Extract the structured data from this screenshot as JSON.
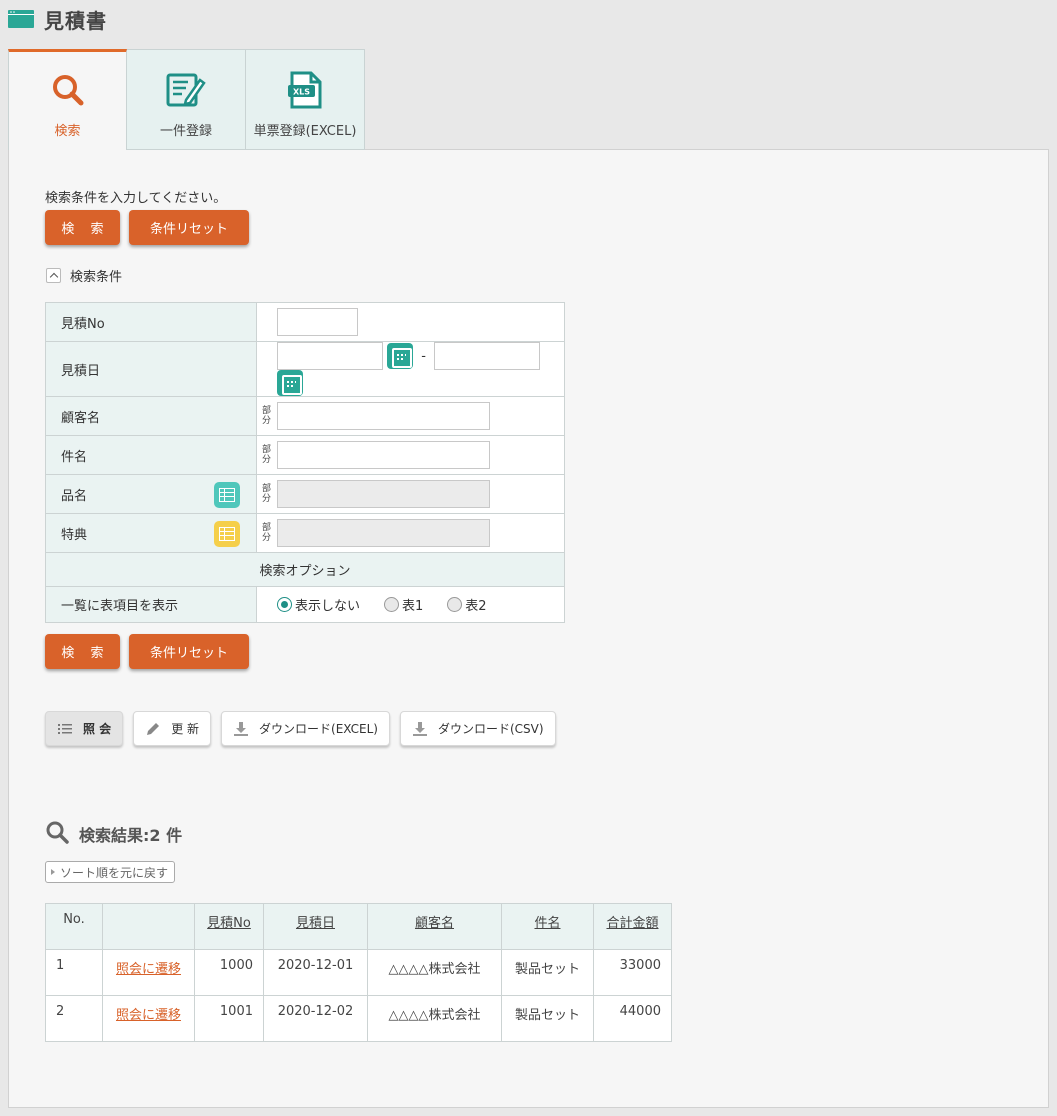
{
  "page": {
    "title": "見積書"
  },
  "tabs": [
    {
      "label": "検索",
      "icon": "search-icon",
      "active": true
    },
    {
      "label": "一件登録",
      "icon": "edit-form-icon",
      "active": false
    },
    {
      "label": "単票登録(EXCEL)",
      "icon": "xls-file-icon",
      "active": false
    }
  ],
  "search": {
    "instruction": "検索条件を入力してください。",
    "search_button": "検 索",
    "reset_button": "条件リセット",
    "conditions_toggle": "検索条件",
    "partial_label": "部分",
    "range_separator": "-",
    "fields": {
      "estimate_no": "見積No",
      "estimate_date": "見積日",
      "customer_name": "顧客名",
      "subject": "件名",
      "product_name": "品名",
      "bonus": "特典"
    },
    "options_header": "検索オプション",
    "display_option": {
      "label": "一覧に表項目を表示",
      "choices": [
        "表示しない",
        "表1",
        "表2"
      ],
      "selected": "表示しない"
    }
  },
  "toolbar": {
    "view": "照 会",
    "update": "更 新",
    "download_excel": "ダウンロード(EXCEL)",
    "download_csv": "ダウンロード(CSV)"
  },
  "results": {
    "title": "検索結果:2 件",
    "sort_reset": "ソート順を元に戻す",
    "columns": [
      "No.",
      "",
      "見積No",
      "見積日",
      "顧客名",
      "件名",
      "合計金額"
    ],
    "rows": [
      {
        "no": "1",
        "link": "照会に遷移",
        "estimate_no": "1000",
        "date": "2020-12-01",
        "customer": "△△△△株式会社",
        "subject": "製品セット",
        "total": "33000"
      },
      {
        "no": "2",
        "link": "照会に遷移",
        "estimate_no": "1001",
        "date": "2020-12-02",
        "customer": "△△△△株式会社",
        "subject": "製品セット",
        "total": "44000"
      }
    ]
  },
  "colors": {
    "accent": "#d9622a",
    "teal": "#2aa796",
    "header_bg": "#eaf3f2"
  }
}
